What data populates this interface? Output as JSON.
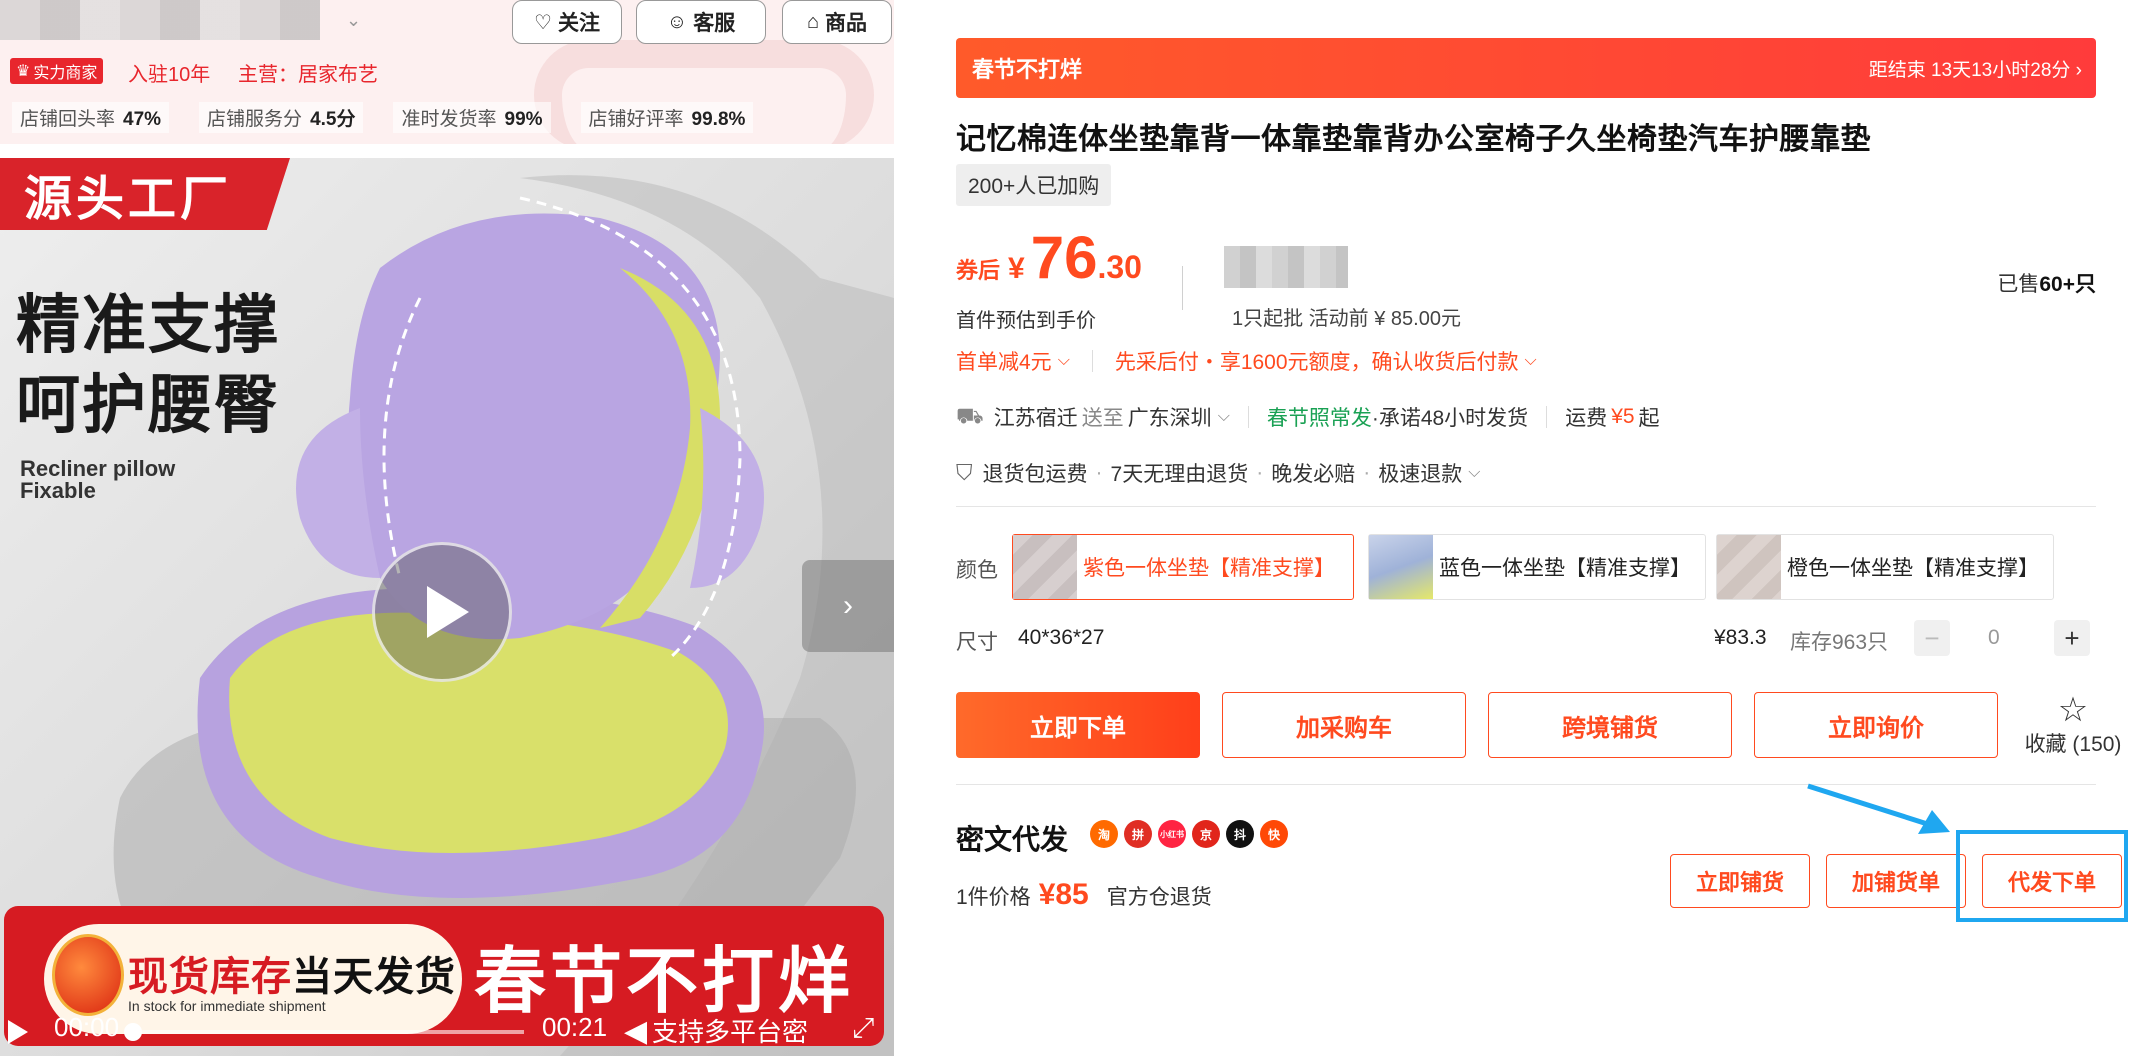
{
  "shop": {
    "follow_label": "关注",
    "service_label": "客服",
    "goods_label": "商品",
    "strength_badge": "实力商家",
    "settled_years": "入驻10年",
    "main_business": "主营：居家布艺",
    "stats": [
      {
        "label": "店铺回头率",
        "value": "47%"
      },
      {
        "label": "店铺服务分",
        "value": "4.5分"
      },
      {
        "label": "准时发货率",
        "value": "99%"
      },
      {
        "label": "店铺好评率",
        "value": "99.8%"
      }
    ]
  },
  "gallery": {
    "tag": "源头工厂",
    "headline_1": "精准支撑",
    "headline_2": "呵护腰臀",
    "english_1": "Recliner pillow",
    "english_2": "Fixable",
    "banner_in_stock": "现货库存",
    "banner_same_day": "当天发货",
    "banner_sub": "In stock for immediate shipment",
    "banner_promo": "春节不打烊",
    "video": {
      "current_time": "00:00",
      "duration": "00:21",
      "overlay_text": "支持多平台密"
    }
  },
  "product": {
    "promo_title": "春节不打烊",
    "countdown": "距结束 13天13小时28分 ›",
    "title": "记忆棉连体坐垫靠背一体靠垫靠背办公室椅子久坐椅垫汽车护腰靠垫",
    "buyers": "200+人已加购",
    "coupon_label": "券后",
    "currency": "¥",
    "price_int": "76",
    "price_dec": ".30",
    "est_label": "首件预估到手价",
    "moq": "1只起批 活动前 ¥ 85.00元",
    "sold_prefix": "已售",
    "sold_value": "60+只",
    "offer_first": "首单减4元",
    "offer_credit": "先采后付・享1600元额度，确认收货后付款",
    "ship_from": "江苏宿迁",
    "ship_to_label": "送至",
    "ship_to": "广东深圳",
    "ship_holiday": "春节照常发",
    "ship_promise": "·承诺48小时发货",
    "freight_label": "运费",
    "freight_value": "¥5",
    "freight_suffix": "起",
    "guarantees": [
      "退货包运费",
      "7天无理由退货",
      "晚发必赔",
      "极速退款"
    ],
    "color_label": "颜色",
    "colors": [
      {
        "label": "紫色一体坐垫【精准支撑】"
      },
      {
        "label": "蓝色一体坐垫【精准支撑】"
      },
      {
        "label": "橙色一体坐垫【精准支撑】"
      }
    ],
    "size_label": "尺寸",
    "size_value": "40*36*27",
    "unit_price": "¥83.3",
    "stock": "库存963只",
    "quantity": "0",
    "buy_now": "立即下单",
    "add_cart": "加采购车",
    "cross_border": "跨境铺货",
    "inquire": "立即询价",
    "favorite": "收藏 (150)"
  },
  "dropship": {
    "title": "密文代发",
    "platforms": [
      "淘",
      "拼",
      "小红书",
      "京",
      "抖",
      "快"
    ],
    "price_label": "1件价格",
    "price_value": "¥85",
    "return_note": "官方仓退货",
    "list_now": "立即铺货",
    "add_list": "加铺货单",
    "order_now": "代发下单"
  },
  "colors": {
    "accent": "#ff4a1f",
    "highlight": "#1fa7f0",
    "green": "#1aa154"
  }
}
